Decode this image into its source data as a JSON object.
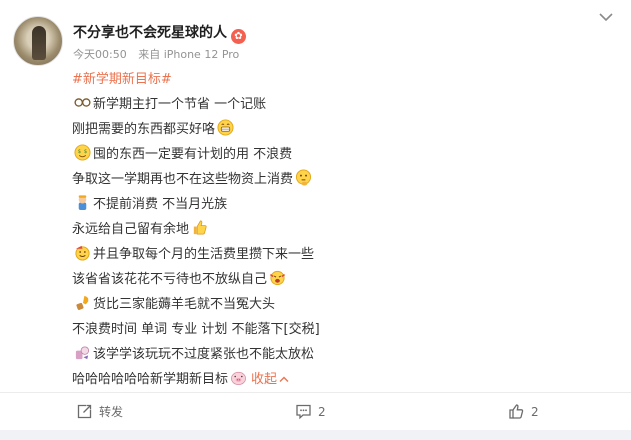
{
  "post": {
    "author": "不分享也不会死星球的人",
    "badge_icon": "vip-badge-icon",
    "time": "今天00:50",
    "source": "来自 iPhone 12 Pro",
    "topic": "#新学期新目标#",
    "lines": [
      {
        "icon": "glasses-emoji",
        "text": "新学期主打一个节省 一个记账"
      },
      {
        "icon": "",
        "text": "刚把需要的东西都买好咯"
      },
      {
        "icon": "money-face-emoji",
        "text": "囤的东西一定要有计划的用 不浪费"
      },
      {
        "icon": "",
        "text": "争取这一学期再也不在这些物资上消费"
      },
      {
        "icon": "mascot-emoji",
        "text": "不提前消费 不当月光族"
      },
      {
        "icon": "",
        "text": "永远给自己留有余地"
      },
      {
        "icon": "party-emoji",
        "text": "并且争取每个月的生活费里攒下来一些"
      },
      {
        "icon": "",
        "text": "该省省该花花不亏待也不放纵自己"
      },
      {
        "icon": "idea-emoji",
        "text": "货比三家能薅羊毛就不当冤大头"
      },
      {
        "icon": "",
        "text": "不浪费时间 单词 专业 计划 不能落下[交税]"
      },
      {
        "icon": "cheer-emoji",
        "text": "该学学该玩玩不过度紧张也不能太放松"
      },
      {
        "icon": "",
        "text": "哈哈哈哈哈哈新学期新目标"
      }
    ],
    "collapse_label": "收起",
    "actions": {
      "repost_label": "转发",
      "comment_count": "2",
      "like_count": "2"
    },
    "colors": {
      "accent": "#eb7350",
      "meta": "#939393"
    }
  }
}
